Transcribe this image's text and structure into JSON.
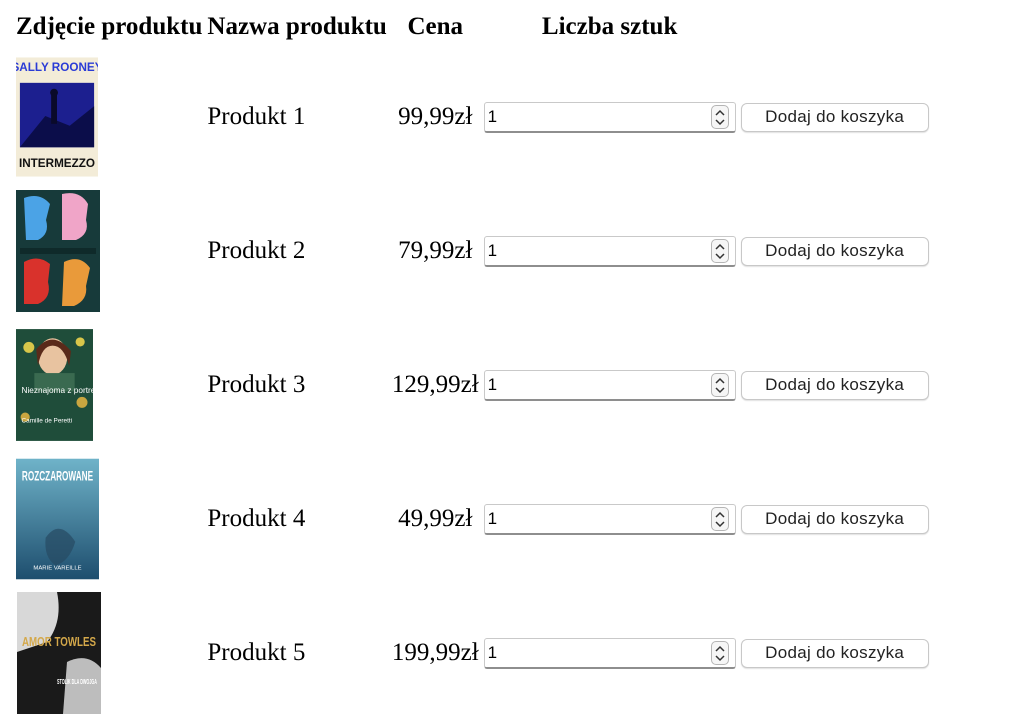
{
  "headers": {
    "photo": "Zdjęcie produktu",
    "name": "Nazwa produktu",
    "price": "Cena",
    "quantity": "Liczba sztuk"
  },
  "products": [
    {
      "name": "Produkt 1",
      "price": "99,99zł",
      "quantity": "1",
      "add_label": "Dodaj do koszyka",
      "cover": {
        "author": "SALLY ROONEY",
        "title": "INTERMEZZO"
      }
    },
    {
      "name": "Produkt 2",
      "price": "79,99zł",
      "quantity": "1",
      "add_label": "Dodaj do koszyka",
      "cover": {
        "title": ""
      }
    },
    {
      "name": "Produkt 3",
      "price": "129,99zł",
      "quantity": "1",
      "add_label": "Dodaj do koszyka",
      "cover": {
        "title": "Nieznajoma z portretu",
        "author": "Camille de Peretti"
      }
    },
    {
      "name": "Produkt 4",
      "price": "49,99zł",
      "quantity": "1",
      "add_label": "Dodaj do koszyka",
      "cover": {
        "title": "ROZCZAROWANE",
        "author": "MARIE VAREILLE"
      }
    },
    {
      "name": "Produkt 5",
      "price": "199,99zł",
      "quantity": "1",
      "add_label": "Dodaj do koszyka",
      "cover": {
        "author": "AMOR TOWLES",
        "title": "STOLIK DLA DWOJGA"
      }
    }
  ]
}
